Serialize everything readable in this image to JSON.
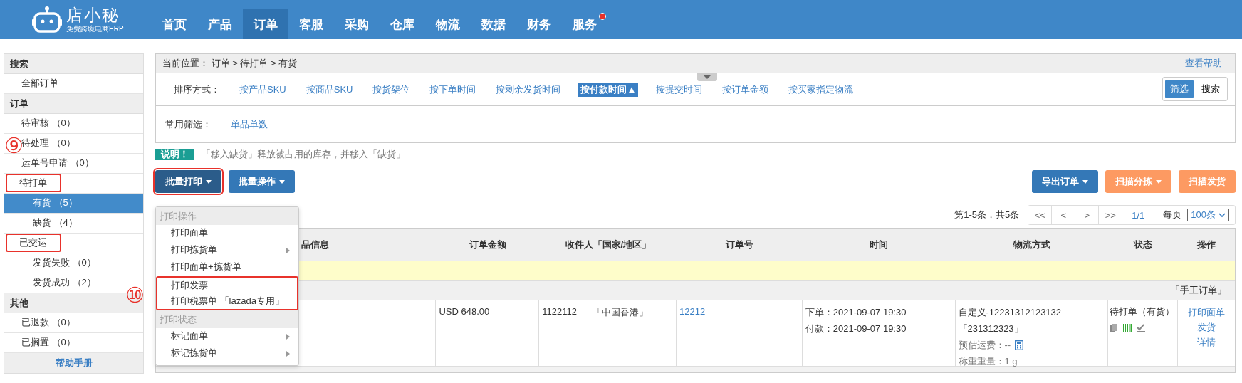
{
  "nav": {
    "logo_name": "店小秘",
    "logo_tagline": "免费跨境电商ERP",
    "items": [
      {
        "label": "首页",
        "selected": false,
        "badge": false
      },
      {
        "label": "产品",
        "selected": false,
        "badge": false
      },
      {
        "label": "订单",
        "selected": true,
        "badge": false
      },
      {
        "label": "客服",
        "selected": false,
        "badge": false
      },
      {
        "label": "采购",
        "selected": false,
        "badge": false
      },
      {
        "label": "仓库",
        "selected": false,
        "badge": false
      },
      {
        "label": "物流",
        "selected": false,
        "badge": false
      },
      {
        "label": "数据",
        "selected": false,
        "badge": false
      },
      {
        "label": "财务",
        "selected": false,
        "badge": false
      },
      {
        "label": "服务",
        "selected": false,
        "badge": true
      }
    ]
  },
  "sidebar": {
    "sections": [
      {
        "title": "搜索",
        "items": [
          {
            "label": "全部订单",
            "selected": false,
            "highlighted": false
          }
        ]
      },
      {
        "title": "订单",
        "items": [
          {
            "label": "待审核 （0）",
            "selected": false,
            "highlighted": false
          },
          {
            "label": "待处理 （0）",
            "selected": false,
            "highlighted": false
          },
          {
            "label": "运单号申请 （0）",
            "selected": false,
            "highlighted": false
          },
          {
            "label": "待打单",
            "selected": false,
            "highlighted": true,
            "children": [
              {
                "label": "有货 （5）",
                "selected": true,
                "highlighted": false
              },
              {
                "label": "缺货 （4）",
                "selected": false,
                "highlighted": false
              }
            ]
          },
          {
            "label": "已交运",
            "selected": false,
            "highlighted": true,
            "children": [
              {
                "label": "发货失败 （0）",
                "selected": false,
                "highlighted": false
              },
              {
                "label": "发货成功 （2）",
                "selected": false,
                "highlighted": false
              }
            ]
          }
        ]
      },
      {
        "title": "其他",
        "items": [
          {
            "label": "已退款 （0）",
            "selected": false,
            "highlighted": false
          },
          {
            "label": "已搁置 （0）",
            "selected": false,
            "highlighted": false
          }
        ]
      }
    ],
    "footer_link": "帮助手册"
  },
  "breadcrumb": {
    "text": "当前位置：  订单 > 待打单 > 有货",
    "help": "查看帮助"
  },
  "sort": {
    "label": "排序方式：",
    "options": [
      {
        "label": "按产品SKU",
        "selected": false
      },
      {
        "label": "按商品SKU",
        "selected": false
      },
      {
        "label": "按货架位",
        "selected": false
      },
      {
        "label": "按下单时间",
        "selected": false
      },
      {
        "label": "按剩余发货时间",
        "selected": false
      },
      {
        "label": "按付款时间",
        "selected": true,
        "indicator": "▲"
      },
      {
        "label": "按提交时间",
        "selected": false
      },
      {
        "label": "按订单金额",
        "selected": false
      },
      {
        "label": "按买家指定物流",
        "selected": false
      }
    ]
  },
  "view_toggle": [
    {
      "label": "筛选",
      "selected": true
    },
    {
      "label": "搜索",
      "selected": false
    }
  ],
  "filter": {
    "label": "常用筛选：",
    "options": [
      "单品单数"
    ]
  },
  "notice": {
    "tag": "说明！",
    "text": "「移入缺货」释放被占用的库存，并移入「缺货」"
  },
  "toolbar_left": [
    {
      "label": "批量打印",
      "kind": "dark",
      "dropdown": true,
      "highlighted": true
    },
    {
      "label": "批量操作",
      "kind": "primary",
      "dropdown": true,
      "highlighted": false
    }
  ],
  "toolbar_right": [
    {
      "label": "导出订单",
      "kind": "primary",
      "dropdown": true,
      "highlighted": false
    },
    {
      "label": "扫描分拣",
      "kind": "warning",
      "dropdown": true,
      "highlighted": false
    },
    {
      "label": "扫描发货",
      "kind": "warning",
      "dropdown": false,
      "highlighted": false
    }
  ],
  "pagination": {
    "summary": "第1-5条，共5条",
    "buttons": [
      "<<",
      "<",
      ">",
      ">>"
    ],
    "page": "1/1",
    "per_page_label": "每页",
    "per_page": "100条"
  },
  "table": {
    "columns": [
      "品信息",
      "订单金额",
      "收件人「国家/地区」",
      "订单号",
      "时间",
      "物流方式",
      "状态",
      "操作"
    ],
    "group_label": "「手工订单」",
    "rows": [
      {
        "amount": "USD 648.00",
        "recipient": "1122112",
        "country": "「中国香港」",
        "order_no": "12212",
        "times": [
          "下单：2021-09-07 19:30",
          "付款：2021-09-07 19:30"
        ],
        "logistics": [
          "自定义-12231312123132",
          "「231312323」"
        ],
        "freight": "预估运费：--",
        "weight": "称重重量：1 g",
        "status": "待打单（有货）",
        "actions": [
          "打印面单",
          "发货",
          "详情"
        ]
      }
    ]
  },
  "dropdown_menu": {
    "groups": [
      {
        "title": "打印操作",
        "items": [
          {
            "label": "打印面单",
            "submenu": false,
            "highlighted": false
          },
          {
            "label": "打印拣货单",
            "submenu": true,
            "highlighted": false
          },
          {
            "label": "打印面单+拣货单",
            "submenu": false,
            "highlighted": false
          },
          {
            "label": "打印发票",
            "submenu": false,
            "highlighted": true
          },
          {
            "label": "打印税票单 「lazada专用」",
            "submenu": false,
            "highlighted": true
          }
        ]
      },
      {
        "title": "打印状态",
        "items": [
          {
            "label": "标记面单",
            "submenu": true,
            "highlighted": false
          },
          {
            "label": "标记拣货单",
            "submenu": true,
            "highlighted": false
          }
        ]
      }
    ]
  },
  "annotations": [
    {
      "label": "⑨"
    },
    {
      "label": "⑩"
    }
  ]
}
